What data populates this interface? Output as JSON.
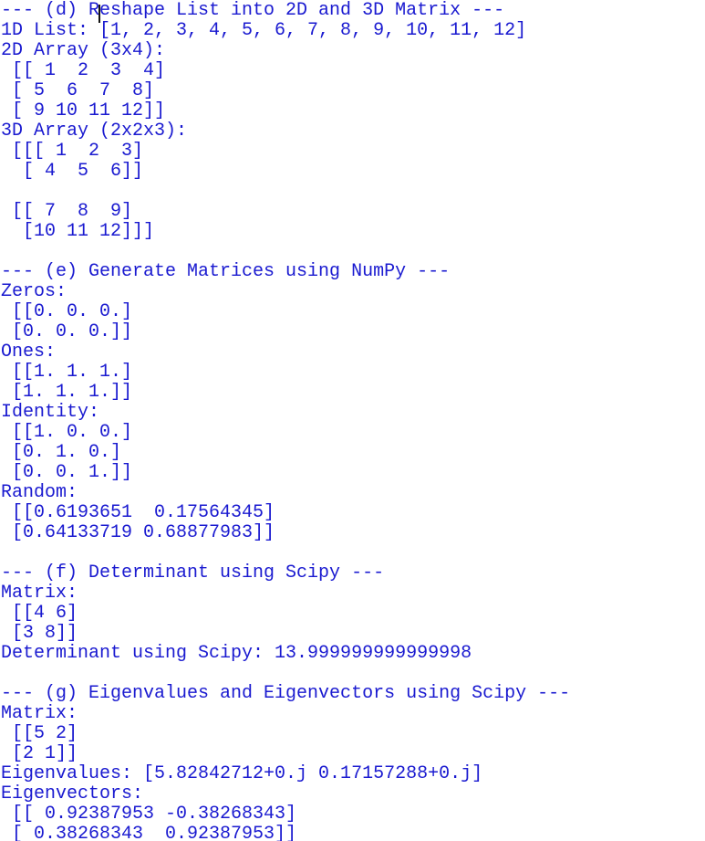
{
  "terminal": {
    "text_color": "#1a1ad0",
    "background": "#ffffff",
    "lines": [
      "--- (d) Reshape List into 2D and 3D Matrix ---",
      "1D List: [1, 2, 3, 4, 5, 6, 7, 8, 9, 10, 11, 12]",
      "2D Array (3x4):",
      " [[ 1  2  3  4]",
      " [ 5  6  7  8]",
      " [ 9 10 11 12]]",
      "3D Array (2x2x3):",
      " [[[ 1  2  3]",
      "  [ 4  5  6]]",
      "",
      " [[ 7  8  9]",
      "  [10 11 12]]]",
      "",
      "--- (e) Generate Matrices using NumPy ---",
      "Zeros:",
      " [[0. 0. 0.]",
      " [0. 0. 0.]]",
      "Ones:",
      " [[1. 1. 1.]",
      " [1. 1. 1.]]",
      "Identity:",
      " [[1. 0. 0.]",
      " [0. 1. 0.]",
      " [0. 0. 1.]]",
      "Random:",
      " [[0.6193651  0.17564345]",
      " [0.64133719 0.68877983]]",
      "",
      "--- (f) Determinant using Scipy ---",
      "Matrix:",
      " [[4 6]",
      " [3 8]]",
      "Determinant using Scipy: 13.999999999999998",
      "",
      "--- (g) Eigenvalues and Eigenvectors using Scipy ---",
      "Matrix:",
      " [[5 2]",
      " [2 1]]",
      "Eigenvalues: [5.82842712+0.j 0.17157288+0.j]",
      "Eigenvectors:",
      " [[ 0.92387953 -0.38268343]",
      " [ 0.38268343  0.92387953]]"
    ]
  }
}
